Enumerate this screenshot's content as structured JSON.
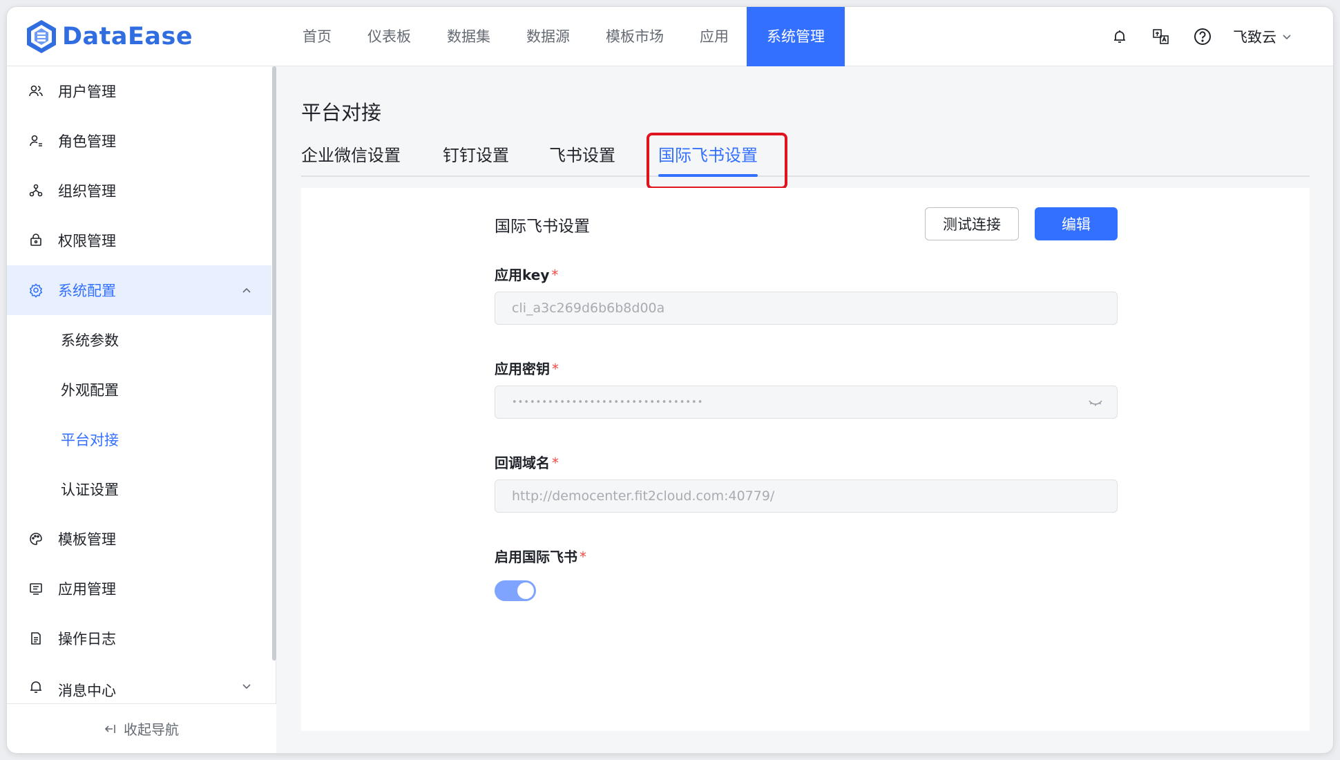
{
  "app": {
    "name": "DataEase"
  },
  "nav": {
    "items": [
      "首页",
      "仪表板",
      "数据集",
      "数据源",
      "模板市场",
      "应用",
      "系统管理"
    ],
    "active_index": 6
  },
  "header": {
    "user_name": "飞致云"
  },
  "sidebar": {
    "menu": [
      {
        "label": "用户管理",
        "icon": "users-icon"
      },
      {
        "label": "角色管理",
        "icon": "role-icon"
      },
      {
        "label": "组织管理",
        "icon": "org-icon"
      },
      {
        "label": "权限管理",
        "icon": "lock-icon"
      },
      {
        "label": "系统配置",
        "icon": "gear-icon",
        "expanded": true
      },
      {
        "label": "模板管理",
        "icon": "palette-icon"
      },
      {
        "label": "应用管理",
        "icon": "app-icon"
      },
      {
        "label": "操作日志",
        "icon": "log-icon"
      },
      {
        "label": "消息中心",
        "icon": "bell-icon"
      }
    ],
    "sub_items": [
      "系统参数",
      "外观配置",
      "平台对接",
      "认证设置"
    ],
    "active_sub": "平台对接",
    "collapse_label": "收起导航"
  },
  "page": {
    "title": "平台对接",
    "tabs": [
      "企业微信设置",
      "钉钉设置",
      "飞书设置",
      "国际飞书设置"
    ],
    "active_tab": "国际飞书设置"
  },
  "form": {
    "title": "国际飞书设置",
    "test_button": "测试连接",
    "edit_button": "编辑",
    "fields": [
      {
        "label": "应用key",
        "value": "cli_a3c269d6b6b8d00a",
        "required": true
      },
      {
        "label": "应用密钥",
        "value": "••••••••••••••••••••••••••••••••",
        "required": true
      },
      {
        "label": "回调域名",
        "value": "http://democenter.fit2cloud.com:40779/",
        "required": true
      }
    ],
    "toggle_label": "启用国际飞书",
    "toggle_on": true
  },
  "colors": {
    "primary": "#3370ff",
    "highlight": "#e0141e"
  }
}
